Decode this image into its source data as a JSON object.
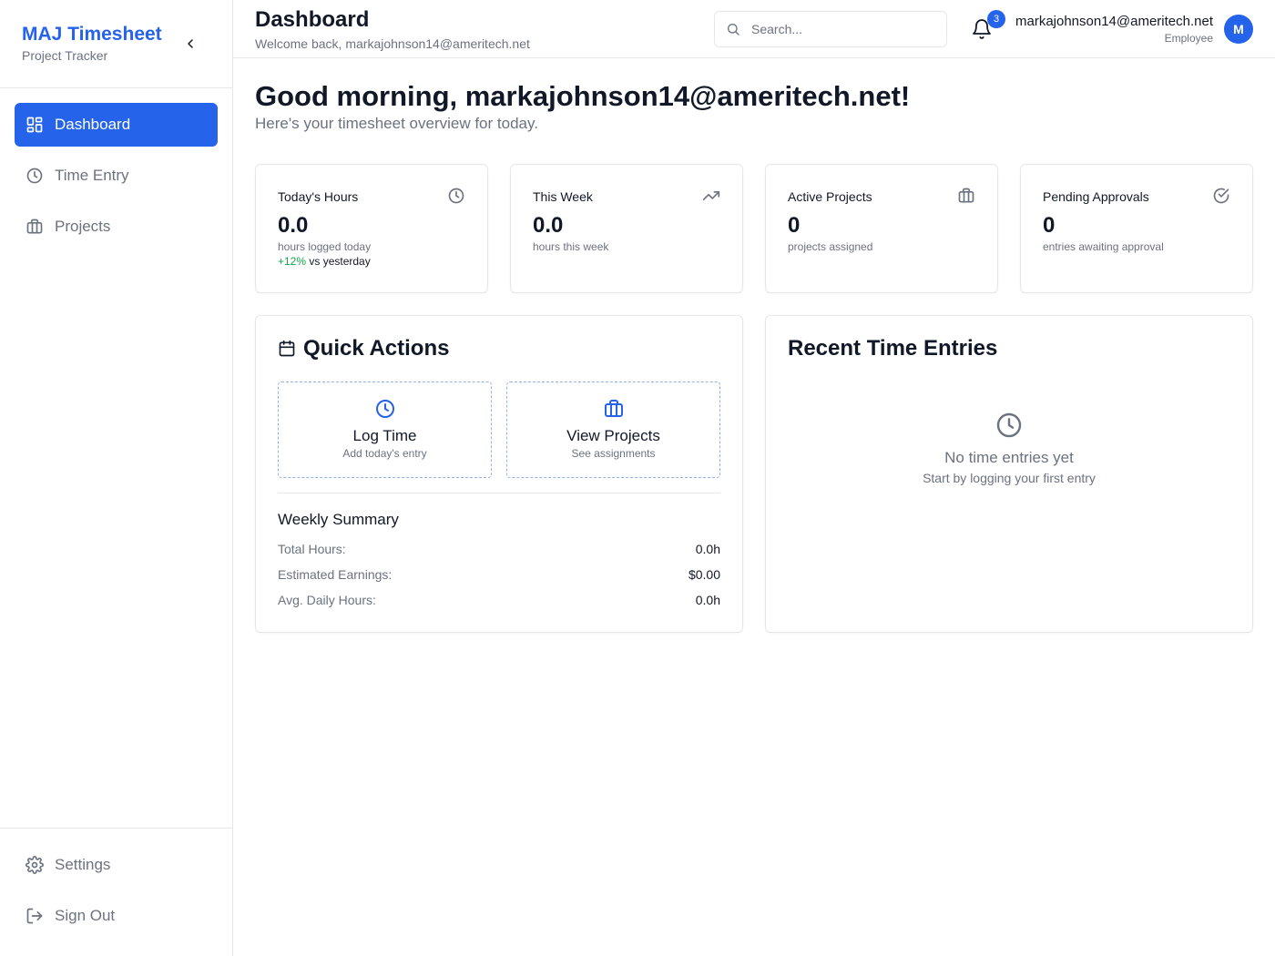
{
  "sidebar": {
    "brand_title": "MAJ Timesheet",
    "brand_subtitle": "Project Tracker",
    "collapse_icon": "chevron-left-icon",
    "items": [
      {
        "label": "Dashboard",
        "icon": "layout-grid-icon",
        "active": true
      },
      {
        "label": "Time Entry",
        "icon": "clock-icon",
        "active": false
      },
      {
        "label": "Projects",
        "icon": "briefcase-icon",
        "active": false
      }
    ],
    "bottom_items": [
      {
        "label": "Settings",
        "icon": "gear-icon"
      },
      {
        "label": "Sign Out",
        "icon": "sign-out-icon"
      }
    ]
  },
  "header": {
    "title": "Dashboard",
    "welcome": "Welcome back, markajohnson14@ameritech.net",
    "search_placeholder": "Search...",
    "notification_count": "3",
    "user_email": "markajohnson14@ameritech.net",
    "user_role": "Employee",
    "avatar_initial": "M"
  },
  "main": {
    "greeting": "Good morning, markajohnson14@ameritech.net!",
    "greeting_sub": "Here's your timesheet overview for today.",
    "stats": [
      {
        "label": "Today's Hours",
        "value": "0.0",
        "note": "hours logged today",
        "trend_value": "+12%",
        "trend_text": "vs yesterday",
        "icon": "clock-icon"
      },
      {
        "label": "This Week",
        "value": "0.0",
        "note": "hours this week",
        "icon": "trending-up-icon"
      },
      {
        "label": "Active Projects",
        "value": "0",
        "note": "projects assigned",
        "icon": "briefcase-icon"
      },
      {
        "label": "Pending Approvals",
        "value": "0",
        "note": "entries awaiting approval",
        "icon": "check-circle-icon"
      }
    ],
    "quick_actions": {
      "title": "Quick Actions",
      "buttons": [
        {
          "title": "Log Time",
          "subtitle": "Add today's entry",
          "icon": "clock-icon"
        },
        {
          "title": "View Projects",
          "subtitle": "See assignments",
          "icon": "briefcase-icon"
        }
      ],
      "weekly_summary": {
        "title": "Weekly Summary",
        "rows": [
          {
            "label": "Total Hours:",
            "value": "0.0h"
          },
          {
            "label": "Estimated Earnings:",
            "value": "$0.00"
          },
          {
            "label": "Avg. Daily Hours:",
            "value": "0.0h"
          }
        ]
      }
    },
    "recent_entries": {
      "title": "Recent Time Entries",
      "empty_title": "No time entries yet",
      "empty_subtitle": "Start by logging your first entry"
    }
  },
  "colors": {
    "accent": "#2563eb",
    "positive": "#16a34a",
    "muted_text": "#6b7280",
    "border": "#e5e7eb"
  }
}
